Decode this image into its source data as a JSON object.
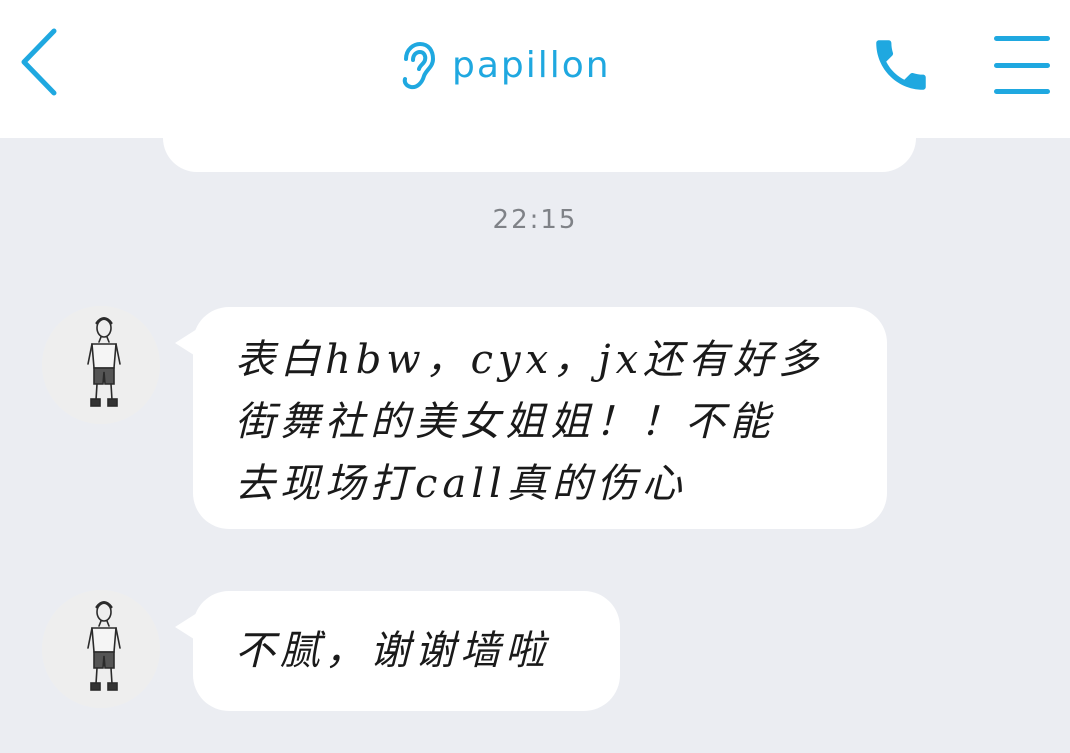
{
  "header": {
    "title": "papillon",
    "back_icon": "chevron-left-icon",
    "title_icon": "ear-icon",
    "call_icon": "phone-icon",
    "menu_icon": "hamburger-menu-icon",
    "accent_color": "#1fa8e0"
  },
  "conversation": {
    "timestamp": "22:15",
    "messages": [
      {
        "sender": "papillon",
        "lines": [
          "表白hbw，cyx，jx还有好多",
          "街舞社的美女姐姐！！不能",
          "去现场打call真的伤心"
        ]
      },
      {
        "sender": "papillon",
        "lines": [
          "不腻，谢谢墙啦"
        ]
      }
    ]
  }
}
